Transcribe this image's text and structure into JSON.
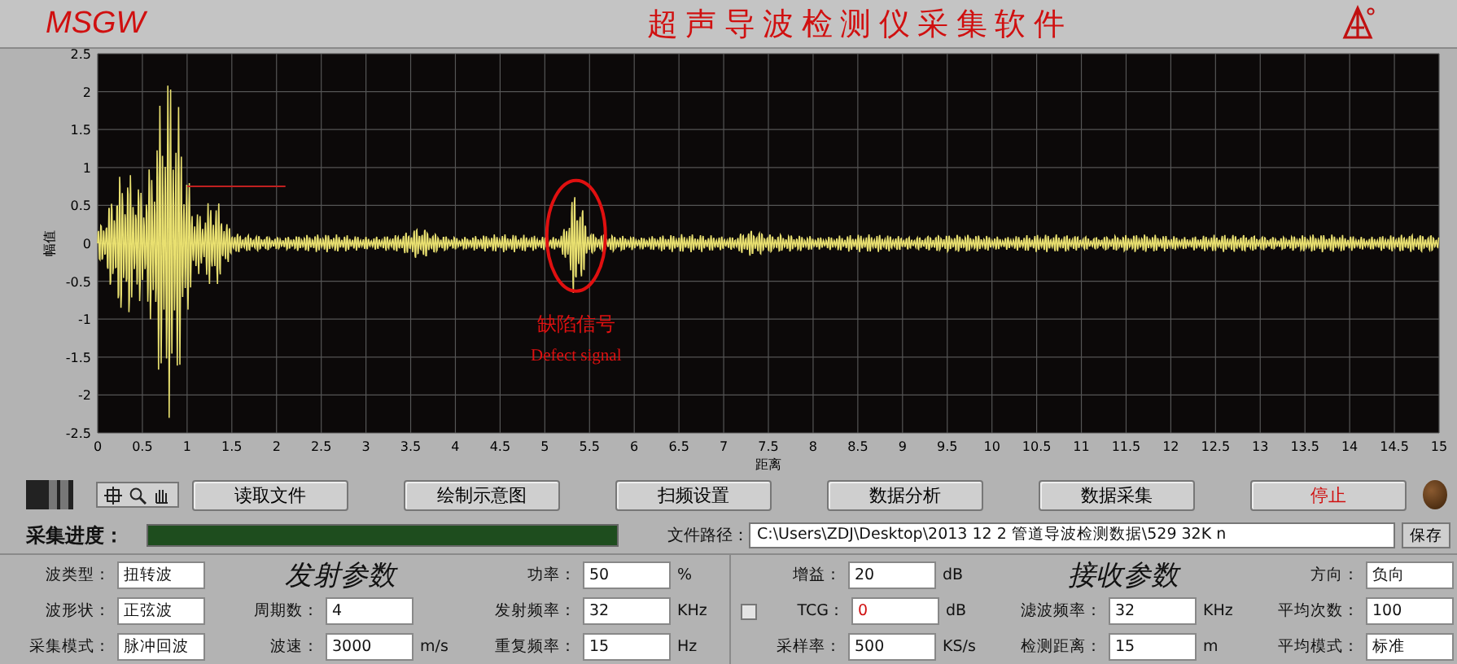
{
  "header": {
    "logo_text": "MSGW",
    "title": "超 声 导 波 检 测 仪 采 集 软 件"
  },
  "chart": {
    "ylabel": "幅值",
    "xlabel": "距离",
    "yticks": [
      "2.5",
      "2",
      "1.5",
      "1",
      "0.5",
      "0",
      "-0.5",
      "-1",
      "-1.5",
      "-2",
      "-2.5"
    ],
    "xticks": [
      "0",
      "0.5",
      "1",
      "1.5",
      "2",
      "2.5",
      "3",
      "3.5",
      "4",
      "4.5",
      "5",
      "5.5",
      "6",
      "6.5",
      "7",
      "7.5",
      "8",
      "8.5",
      "9",
      "9.5",
      "10",
      "10.5",
      "11",
      "11.5",
      "12",
      "12.5",
      "13",
      "13.5",
      "14",
      "14.5",
      "15"
    ],
    "annotation": {
      "label": "缺陷信号",
      "caption": "Defect signal"
    }
  },
  "toolbar": {
    "buttons": [
      {
        "label": "读取文件",
        "kind": "normal"
      },
      {
        "label": "绘制示意图",
        "kind": "normal"
      },
      {
        "label": "扫频设置",
        "kind": "normal"
      },
      {
        "label": "数据分析",
        "kind": "normal"
      },
      {
        "label": "数据采集",
        "kind": "normal"
      },
      {
        "label": "停止",
        "kind": "stop"
      }
    ],
    "indicator": {
      "on": false
    }
  },
  "progress": {
    "label": "采集进度：",
    "level": 1.0
  },
  "file": {
    "label": "文件路径：",
    "value": "C:\\Users\\ZDJ\\Desktop\\2013 12 2 管道导波检测数据\\529 32K n",
    "button": "保存"
  },
  "transmit": {
    "title": "发射参数",
    "columns": [
      [
        {
          "label": "波类型：",
          "value": "扭转波"
        },
        {
          "label": "波形状：",
          "value": "正弦波"
        },
        {
          "label": "采集模式：",
          "value": "脉冲回波"
        }
      ],
      [
        {
          "label": "周期数：",
          "value": "4"
        },
        {
          "label": "波速：",
          "value": "3000",
          "unit": "m/s"
        }
      ],
      [
        {
          "label": "功率：",
          "value": "50",
          "unit": "%"
        },
        {
          "label": "发射频率：",
          "value": "32",
          "unit": "KHz"
        },
        {
          "label": "重复频率：",
          "value": "15",
          "unit": "Hz"
        }
      ]
    ]
  },
  "receive": {
    "title": "接收参数",
    "columns": [
      [
        {
          "label": "增益：",
          "value": "20",
          "unit": "dB"
        },
        {
          "label": "TCG：",
          "value": "0",
          "unit": "dB",
          "checkbox": {
            "checked": false
          },
          "highlight": true
        },
        {
          "label": "采样率：",
          "value": "500",
          "unit": "KS/s"
        }
      ],
      [
        {
          "label": "滤波频率：",
          "value": "32",
          "unit": "KHz"
        },
        {
          "label": "检测距离：",
          "value": "15",
          "unit": "m"
        }
      ],
      [
        {
          "label": "方向：",
          "value": "负向"
        },
        {
          "label": "平均次数：",
          "value": "100"
        },
        {
          "label": "平均模式：",
          "value": "标准"
        }
      ]
    ]
  }
}
